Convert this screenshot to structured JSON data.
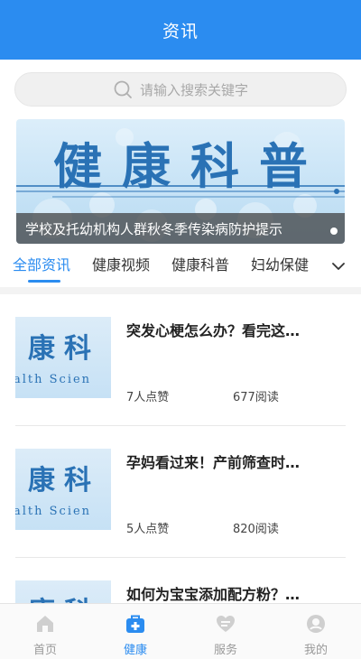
{
  "header": {
    "title": "资讯"
  },
  "search": {
    "placeholder": "请输入搜索关键字"
  },
  "banner": {
    "title": "健康科普",
    "caption": "学校及托幼机构人群秋冬季传染病防护提示"
  },
  "tabs": [
    {
      "label": "全部资讯",
      "active": true
    },
    {
      "label": "健康视频",
      "active": false
    },
    {
      "label": "健康科普",
      "active": false
    },
    {
      "label": "妇幼保健",
      "active": false
    }
  ],
  "articles": [
    {
      "title": "突发心梗怎么办？看完这…",
      "likes": "7人点赞",
      "reads": "677阅读",
      "thumb_title": "康科",
      "thumb_sub": "alth Scien"
    },
    {
      "title": "孕妈看过来！产前筛查时…",
      "likes": "5人点赞",
      "reads": "820阅读",
      "thumb_title": "康科",
      "thumb_sub": "alth Scien"
    },
    {
      "title": "如何为宝宝添加配方粉？…",
      "thumb_title": "康科"
    }
  ],
  "tabbar": [
    {
      "label": "首页",
      "icon": "home-icon",
      "active": false
    },
    {
      "label": "健康",
      "icon": "medical-kit-icon",
      "active": true
    },
    {
      "label": "服务",
      "icon": "heart-service-icon",
      "active": false
    },
    {
      "label": "我的",
      "icon": "profile-icon",
      "active": false
    }
  ],
  "colors": {
    "primary": "#2b8cf0",
    "text": "#222222",
    "muted": "#999999",
    "banner_text": "#2a72b5"
  }
}
